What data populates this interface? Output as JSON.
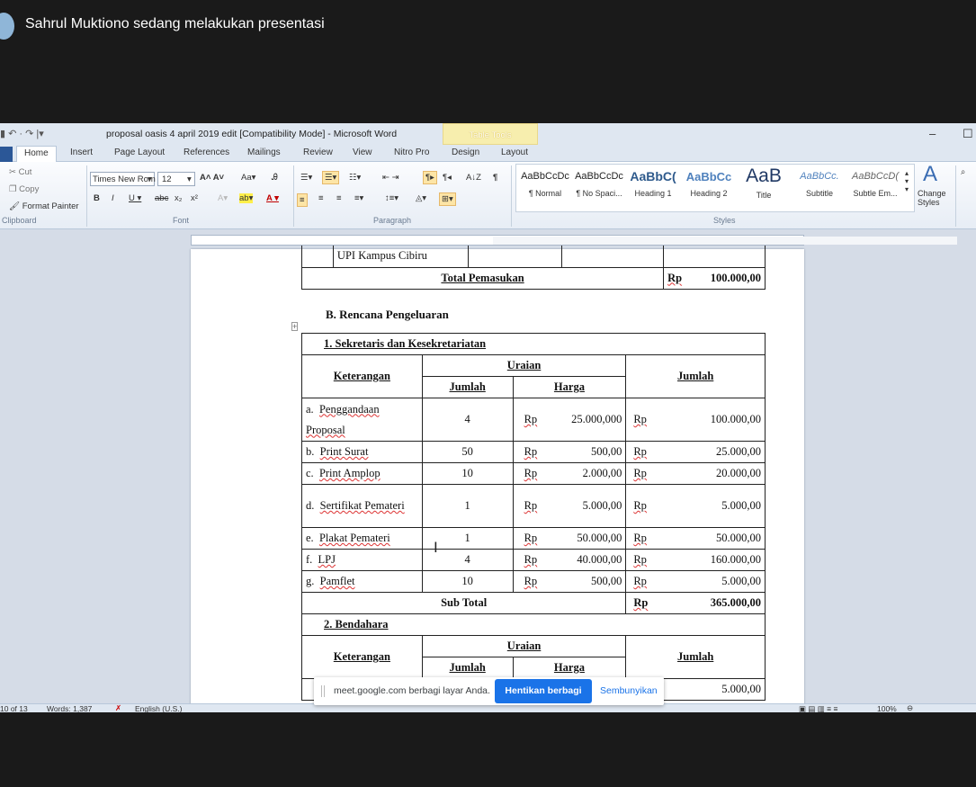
{
  "meet": {
    "presenter_banner": "Sahrul Muktiono sedang melakukan presentasi",
    "share_notice": "meet.google.com berbagi layar Anda.",
    "stop_share_label": "Hentikan berbagi",
    "hide_label": "Sembunyikan"
  },
  "word": {
    "title": "proposal oasis 4 april 2019 edit [Compatibility Mode]  -  Microsoft Word",
    "table_tools": "Table Tools",
    "tabs": [
      "Home",
      "Insert",
      "Page Layout",
      "References",
      "Mailings",
      "Review",
      "View",
      "Nitro Pro",
      "Design",
      "Layout"
    ],
    "clipboard": {
      "cut": "Cut",
      "copy": "Copy",
      "format_painter": "Format Painter",
      "label": "Clipboard"
    },
    "font": {
      "name": "Times New Rom",
      "size": "12",
      "label": "Font"
    },
    "paragraph_label": "Paragraph",
    "styles": [
      {
        "sample": "AaBbCcDc",
        "name": "¶ Normal"
      },
      {
        "sample": "AaBbCcDc",
        "name": "¶ No Spaci..."
      },
      {
        "sample": "AaBbC(",
        "name": "Heading 1"
      },
      {
        "sample": "AaBbCc",
        "name": "Heading 2"
      },
      {
        "sample": "AaB",
        "name": "Title"
      },
      {
        "sample": "AaBbCc.",
        "name": "Subtitle"
      },
      {
        "sample": "AaBbCcD(",
        "name": "Subtle Em..."
      }
    ],
    "change_styles": "Change Styles",
    "styles_label": "Styles",
    "status": {
      "page": "10 of 13",
      "words": "Words: 1,387",
      "language": "English (U.S.)",
      "zoom": "100%"
    }
  },
  "doc": {
    "top_row_text": "UPI Kampus Cibiru",
    "total_pemasukan_label": "Total Pemasukan",
    "total_pemasukan_currency": "Rp",
    "total_pemasukan_value": "100.000,00",
    "section_b": "B.  Rencana Pengeluaran",
    "sub1": "1.   Sekretaris dan Kesekretariatan",
    "headers": {
      "keterangan": "Keterangan",
      "uraian": "Uraian",
      "jumlah_col": "Jumlah",
      "harga": "Harga",
      "jumlah_total": "Jumlah"
    },
    "rows": [
      {
        "letter": "a.",
        "item": "Penggandaan Proposal",
        "qty": "4",
        "cur1": "Rp",
        "price": "25.000,000",
        "cur2": "Rp",
        "total": "100.000,00"
      },
      {
        "letter": "b.",
        "item": "Print Surat",
        "qty": "50",
        "cur1": "Rp",
        "price": "500,00",
        "cur2": "Rp",
        "total": "25.000,00"
      },
      {
        "letter": "c.",
        "item": "Print Amplop",
        "qty": "10",
        "cur1": "Rp",
        "price": "2.000,00",
        "cur2": "Rp",
        "total": "20.000,00"
      },
      {
        "letter": "d.",
        "item": "Sertifikat Pemateri",
        "qty": "1",
        "cur1": "Rp",
        "price": "5.000,00",
        "cur2": "Rp",
        "total": "5.000,00"
      },
      {
        "letter": "e.",
        "item": "Plakat Pemateri",
        "qty": "1",
        "cur1": "Rp",
        "price": "50.000,00",
        "cur2": "Rp",
        "total": "50.000,00"
      },
      {
        "letter": "f.",
        "item": "LPJ",
        "qty": "4",
        "cur1": "Rp",
        "price": "40.000,00",
        "cur2": "Rp",
        "total": "160.000,00"
      },
      {
        "letter": "g.",
        "item": "Pamflet",
        "qty": "10",
        "cur1": "Rp",
        "price": "500,00",
        "cur2": "Rp",
        "total": "5.000,00"
      }
    ],
    "subtotal_label": "Sub Total",
    "subtotal_currency": "Rp",
    "subtotal_value": "365.000,00",
    "sub2": "2.   Bendahara",
    "partial_total": "5.000,00"
  }
}
